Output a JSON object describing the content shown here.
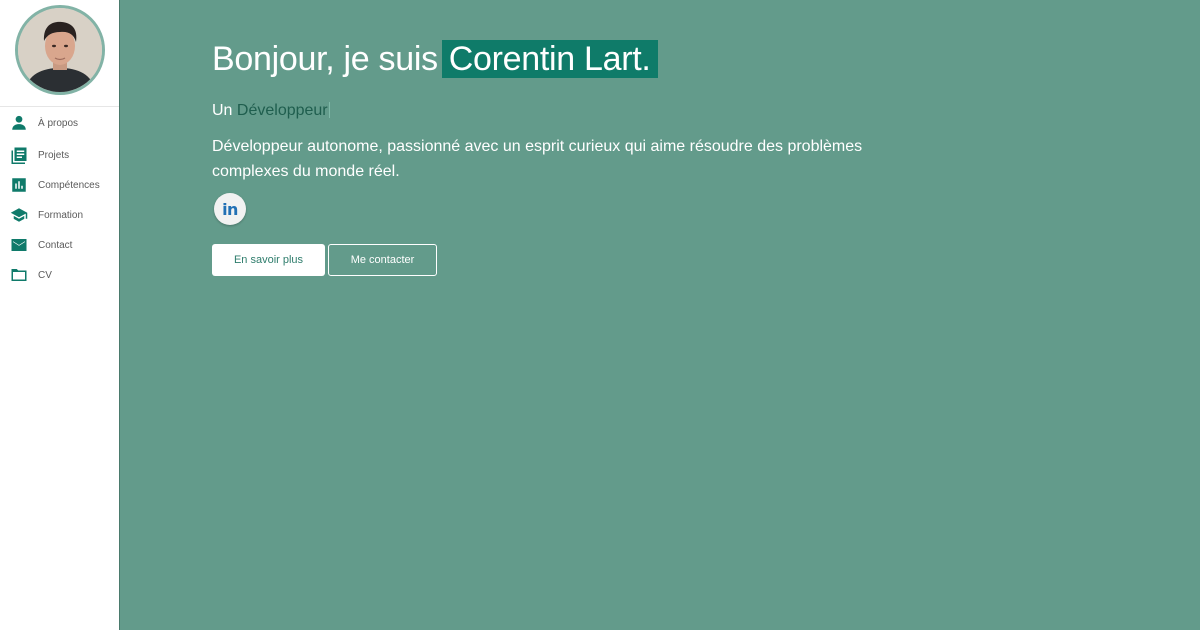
{
  "sidebar": {
    "avatar_alt": "Corentin Lart",
    "items": [
      {
        "label": "À propos",
        "icon": "person-icon"
      },
      {
        "label": "Projets",
        "icon": "list-icon"
      },
      {
        "label": "Compétences",
        "icon": "bar-chart-icon"
      },
      {
        "label": "Formation",
        "icon": "graduation-cap-icon"
      },
      {
        "label": "Contact",
        "icon": "mail-icon"
      },
      {
        "label": "CV",
        "icon": "folder-icon"
      }
    ]
  },
  "hero": {
    "greeting": "Bonjour, je suis",
    "name": "Corentin Lart.",
    "role_prefix": "Un",
    "role": "Développeur",
    "description": "Développeur autonome, passionné avec un esprit curieux qui aime résoudre des problèmes complexes du monde réel.",
    "linkedin_label": "in",
    "buttons": {
      "learn_more": "En savoir plus",
      "contact": "Me contacter"
    }
  },
  "colors": {
    "background": "#639b8b",
    "accent": "#0f7b69",
    "sidebar_icon": "#0f7a6a",
    "role_text": "#1f5e4e"
  }
}
